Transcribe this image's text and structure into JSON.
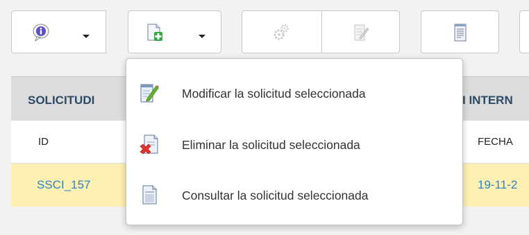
{
  "toolbar": {
    "buttons": [
      {
        "icon": "info-speech-icon",
        "has_dropdown": true
      },
      {
        "icon": "add-document-icon",
        "has_dropdown": true
      },
      {
        "icon": "gears-icon",
        "disabled": true
      },
      {
        "icon": "edit-document-icon",
        "disabled": true
      },
      {
        "icon": "report-document-icon"
      }
    ]
  },
  "table": {
    "title_left": "SOLICITUDI",
    "title_right": "I INTERN",
    "headers": {
      "id": "ID",
      "fecha": "FECHA"
    },
    "row": {
      "id": "SSCI_157",
      "date": "19-11-2"
    }
  },
  "menu": {
    "items": [
      {
        "label": "Modificar la solicitud seleccionada",
        "icon": "edit-pencil-icon"
      },
      {
        "label": "Eliminar la solicitud seleccionada",
        "icon": "delete-document-icon"
      },
      {
        "label": "Consultar la solicitud seleccionada",
        "icon": "view-document-icon"
      }
    ]
  },
  "colors": {
    "toolbar_bg": "#f2f2f2",
    "header_bg": "#dcdcdc",
    "selected_row_bg": "#fdf0b2",
    "link_color": "#2a86c8",
    "title_color": "#2c4a66"
  }
}
